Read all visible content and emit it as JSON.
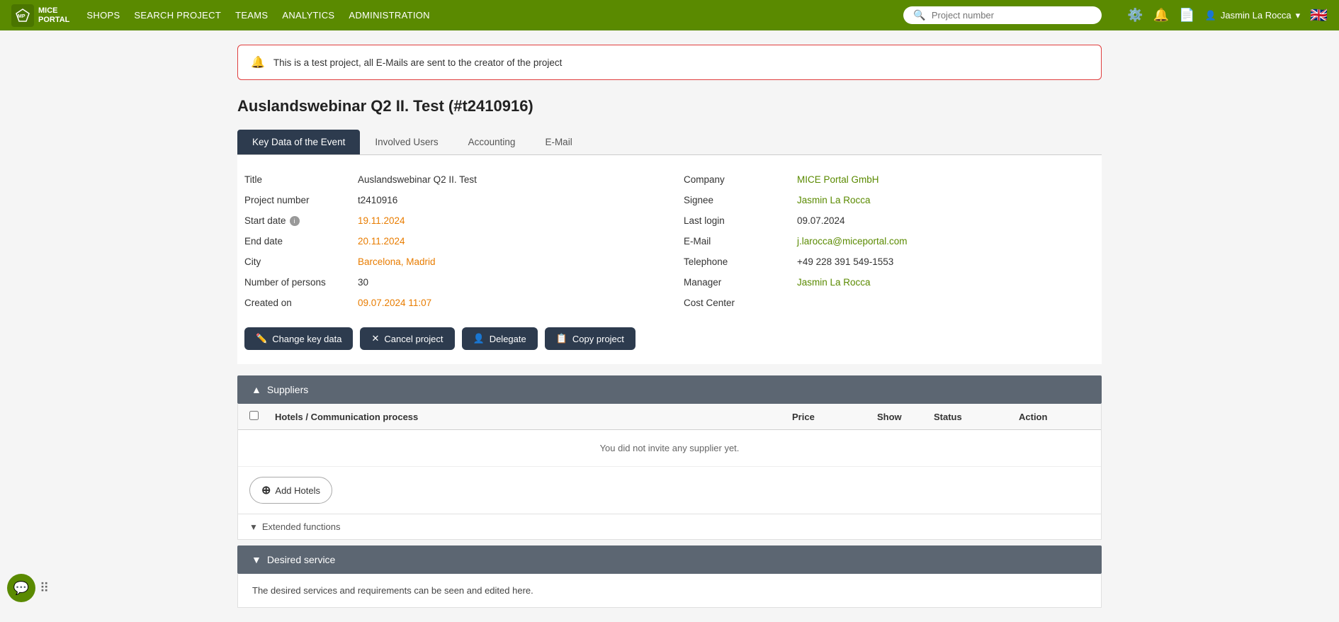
{
  "navbar": {
    "logo_line1": "MICE",
    "logo_line2": "PORTAL",
    "links": [
      {
        "label": "SHOPS",
        "id": "shops"
      },
      {
        "label": "SEARCH PROJECT",
        "id": "search-project"
      },
      {
        "label": "TEAMS",
        "id": "teams"
      },
      {
        "label": "ANALYTICS",
        "id": "analytics"
      },
      {
        "label": "ADMINISTRATION",
        "id": "administration"
      }
    ],
    "search_placeholder": "Project number",
    "user_name": "Jasmin La Rocca"
  },
  "alert": {
    "message": "This is a test project, all E-Mails are sent to the creator of the project"
  },
  "page_title": "Auslandswebinar Q2 II. Test (#t2410916)",
  "tabs": [
    {
      "label": "Key Data of the Event",
      "active": true
    },
    {
      "label": "Involved Users",
      "active": false
    },
    {
      "label": "Accounting",
      "active": false
    },
    {
      "label": "E-Mail",
      "active": false
    }
  ],
  "key_data": {
    "left_fields": [
      {
        "label": "Title",
        "value": "Auslandswebinar Q2 II. Test",
        "type": "normal"
      },
      {
        "label": "Project number",
        "value": "t2410916",
        "type": "normal"
      },
      {
        "label": "Start date",
        "value": "19.11.2024",
        "type": "date",
        "has_info": true
      },
      {
        "label": "End date",
        "value": "20.11.2024",
        "type": "date"
      },
      {
        "label": "City",
        "value": "Barcelona, Madrid",
        "type": "date"
      },
      {
        "label": "Number of persons",
        "value": "30",
        "type": "normal"
      },
      {
        "label": "Created on",
        "value": "09.07.2024 11:07",
        "type": "date"
      }
    ],
    "right_fields": [
      {
        "label": "Company",
        "value": "MICE Portal GmbH",
        "type": "link"
      },
      {
        "label": "Signee",
        "value": "Jasmin La Rocca",
        "type": "link"
      },
      {
        "label": "Last login",
        "value": "09.07.2024",
        "type": "normal"
      },
      {
        "label": "E-Mail",
        "value": "j.larocca@miceportal.com",
        "type": "link"
      },
      {
        "label": "Telephone",
        "value": "+49 228 391 549-1553",
        "type": "normal"
      },
      {
        "label": "Manager",
        "value": "Jasmin La Rocca",
        "type": "link"
      },
      {
        "label": "Cost Center",
        "value": "",
        "type": "normal"
      }
    ]
  },
  "buttons": [
    {
      "label": "Change key data",
      "icon": "✏️",
      "id": "change-key-data"
    },
    {
      "label": "Cancel project",
      "icon": "✕",
      "id": "cancel-project"
    },
    {
      "label": "Delegate",
      "icon": "👤",
      "id": "delegate"
    },
    {
      "label": "Copy project",
      "icon": "📋",
      "id": "copy-project"
    }
  ],
  "suppliers_section": {
    "title": "Suppliers",
    "columns": [
      "",
      "Hotels / Communication process",
      "Price",
      "Show",
      "Status",
      "Action"
    ],
    "empty_message": "You did not invite any supplier yet.",
    "add_button": "Add Hotels"
  },
  "extended_functions": {
    "label": "Extended functions"
  },
  "desired_service": {
    "title": "Desired service",
    "description": "The desired services and requirements can be seen and edited here."
  }
}
